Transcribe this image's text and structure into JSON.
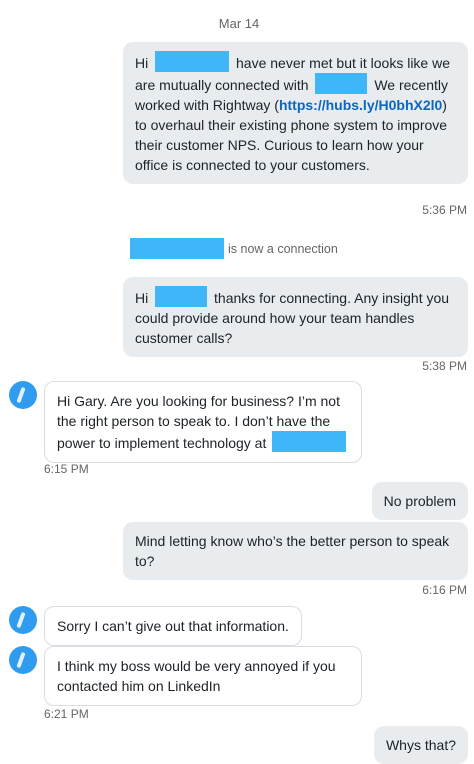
{
  "thread": {
    "date": "Mar 14",
    "msg1": {
      "p1": "Hi",
      "p2": "have never met but it looks like we are mutually connected with",
      "p3": "We recently worked with Rightway (",
      "link": "https://hubs.ly/H0bhX2l0",
      "p4": ") to overhaul their existing phone system to improve their customer NPS. Curious to learn how your office is connected to your customers."
    },
    "time1": "5:36 PM",
    "connection_text": "is now a connection",
    "msg2": {
      "p1": "Hi",
      "p2": "thanks for connecting. Any insight you could provide around how your team handles customer calls?"
    },
    "time2": "5:38 PM",
    "msg3": {
      "p1": "Hi Gary. Are you looking for business? I’m not the right person to speak to. I don’t have the power to implement technology at"
    },
    "time3": "6:15 PM",
    "msg4": "No problem",
    "msg5": "Mind letting know who’s the better person to speak to?",
    "time4": "6:16 PM",
    "msg6": "Sorry I can’t give out that information.",
    "msg7": "I think my boss would be very annoyed if you contacted him on LinkedIn",
    "time5": "6:21 PM",
    "msg8": "Whys that?"
  },
  "colors": {
    "outgoing_bubble": "#e8ecef",
    "incoming_border": "#d9dde1",
    "redaction": "#3fb6f7",
    "link": "#0a66c2",
    "avatar": "#2f9cf0"
  },
  "icons": {
    "avatar": "contact-avatar-icon"
  }
}
